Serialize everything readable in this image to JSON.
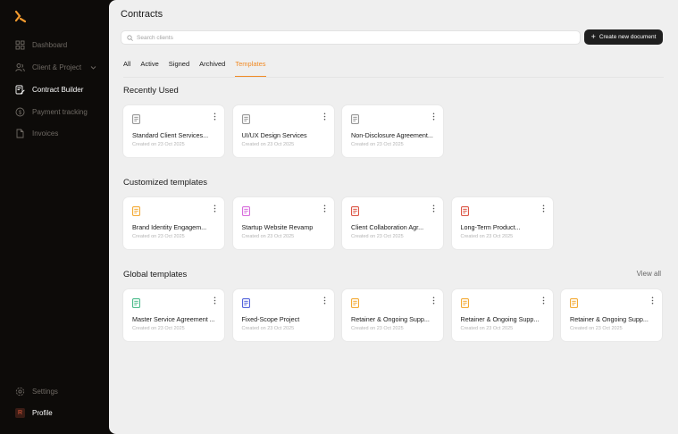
{
  "sidebar": {
    "items": [
      {
        "label": "Dashboard"
      },
      {
        "label": "Client & Project"
      },
      {
        "label": "Contract Builder"
      },
      {
        "label": "Payment tracking"
      },
      {
        "label": "Invoices"
      }
    ],
    "settings": {
      "label": "Settings"
    },
    "profile": {
      "label": "Profile",
      "avatar": "R"
    }
  },
  "header": {
    "title": "Contracts",
    "search_placeholder": "Search clients",
    "create_label": "Create new document"
  },
  "tabs": [
    {
      "label": "All"
    },
    {
      "label": "Active"
    },
    {
      "label": "Signed"
    },
    {
      "label": "Archived"
    },
    {
      "label": "Templates",
      "active": true
    }
  ],
  "sections": {
    "recent": {
      "title": "Recently Used",
      "cards": [
        {
          "name": "Standard Client Services...",
          "date": "Created on 23 Oct 2025",
          "icon_color": "#8a8a8a"
        },
        {
          "name": "UI/UX Design Services",
          "date": "Created on 23 Oct 2025",
          "icon_color": "#8a8a8a"
        },
        {
          "name": "Non-Disclosure Agreement...",
          "date": "Created on 23 Oct 2025",
          "icon_color": "#8a8a8a"
        }
      ]
    },
    "custom": {
      "title": "Customized templates",
      "cards": [
        {
          "name": "Brand Identity Engagem...",
          "date": "Created on 23 Oct 2025",
          "icon_color": "#f2a11f"
        },
        {
          "name": "Startup Website Revamp",
          "date": "Created on 23 Oct 2025",
          "icon_color": "#d25ad8"
        },
        {
          "name": "Client Collaboration Agr...",
          "date": "Created on 23 Oct 2025",
          "icon_color": "#d8412f"
        },
        {
          "name": "Long-Term Product...",
          "date": "Created on 23 Oct 2025",
          "icon_color": "#d8412f"
        }
      ]
    },
    "global": {
      "title": "Global templates",
      "view_all": "View all",
      "cards": [
        {
          "name": "Master Service Agreement ...",
          "date": "Created on 23 Oct 2025",
          "icon_color": "#36b37e"
        },
        {
          "name": "Fixed-Scope Project",
          "date": "Created on 23 Oct 2025",
          "icon_color": "#3f51d8"
        },
        {
          "name": "Retainer & Ongoing Supp...",
          "date": "Created on 23 Oct 2025",
          "icon_color": "#f2a11f"
        },
        {
          "name": "Retainer & Ongoing Supp...",
          "date": "Created on 23 Oct 2025",
          "icon_color": "#f2a11f"
        },
        {
          "name": "Retainer & Ongoing Supp...",
          "date": "Created on 23 Oct 2025",
          "icon_color": "#f2a11f"
        }
      ]
    }
  },
  "colors": {
    "accent": "#f08a24",
    "sidebar_bg": "#0d0b09",
    "main_bg": "#efefef"
  }
}
